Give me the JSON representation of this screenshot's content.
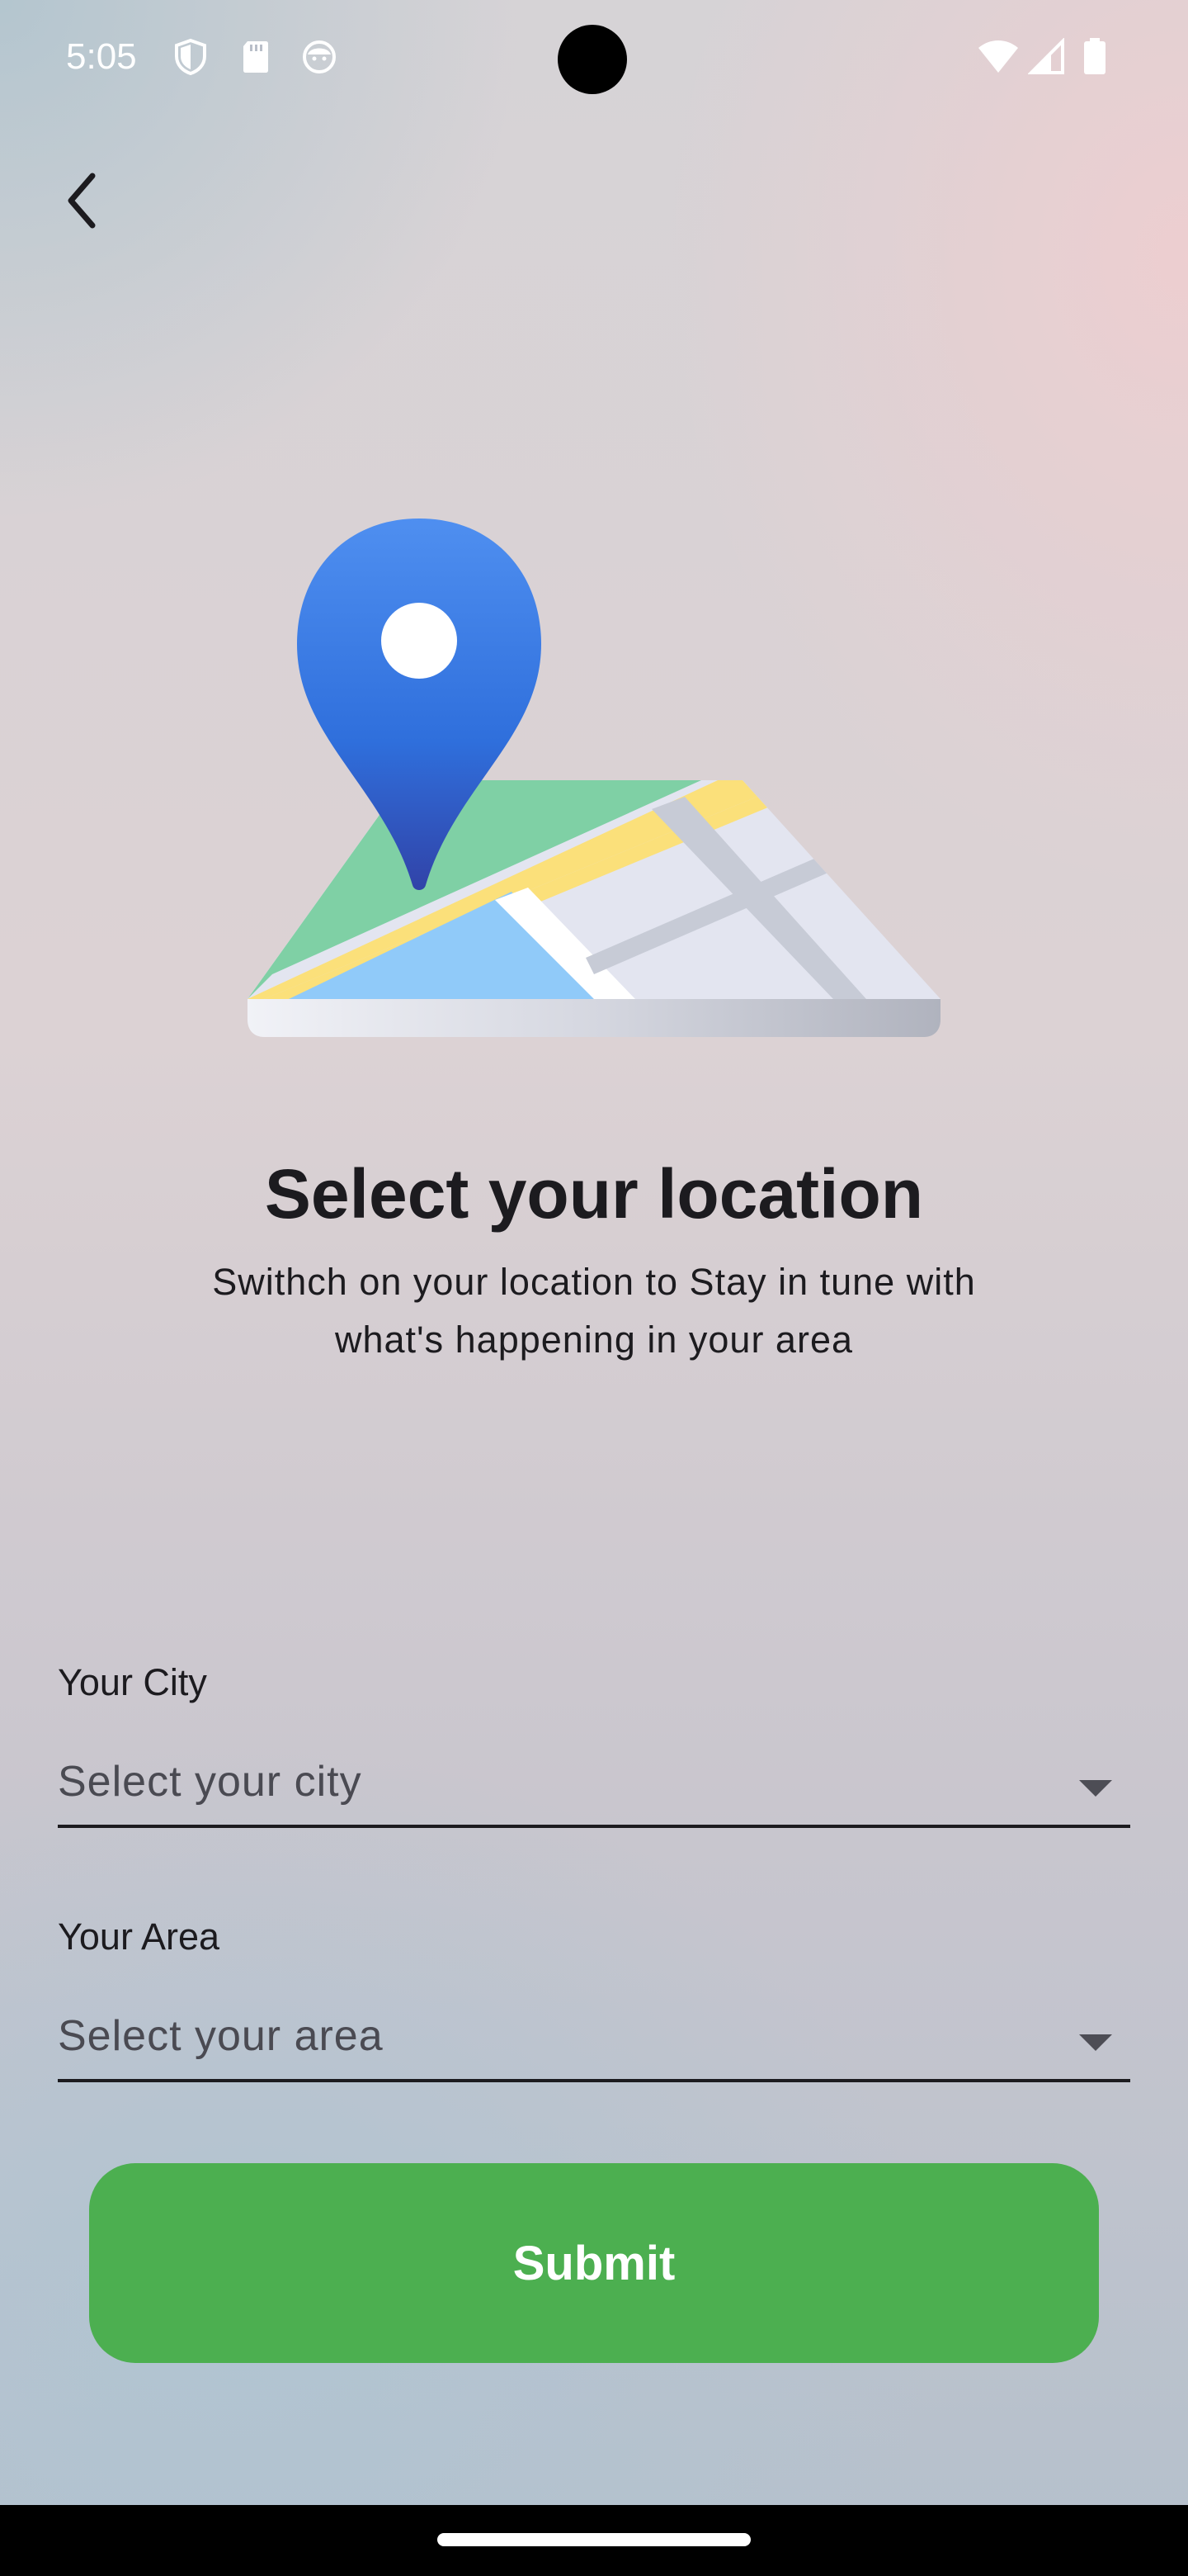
{
  "status_bar": {
    "time": "5:05",
    "left_icons": [
      "shield-icon",
      "sd-card-icon",
      "face-icon"
    ],
    "right_icons": [
      "wifi-icon",
      "signal-icon",
      "battery-icon"
    ]
  },
  "navigation": {
    "back_icon": "chevron-left-icon"
  },
  "illustration": {
    "name": "map-location-pin-illustration",
    "pin_color": "#2f6fdc",
    "map_colors": [
      "#7fd0a5",
      "#fbe07a",
      "#90caf9",
      "#e3e5f0"
    ]
  },
  "header": {
    "title": "Select your location",
    "subtitle_line1": "Swithch on your location to Stay in tune with",
    "subtitle_line2": "what's happening in your area"
  },
  "form": {
    "city": {
      "label": "Your City",
      "placeholder": "Select your city"
    },
    "area": {
      "label": "Your Area",
      "placeholder": "Select your area"
    },
    "submit_label": "Submit"
  },
  "colors": {
    "accent": "#4caf50",
    "text": "#1c1b1f"
  }
}
